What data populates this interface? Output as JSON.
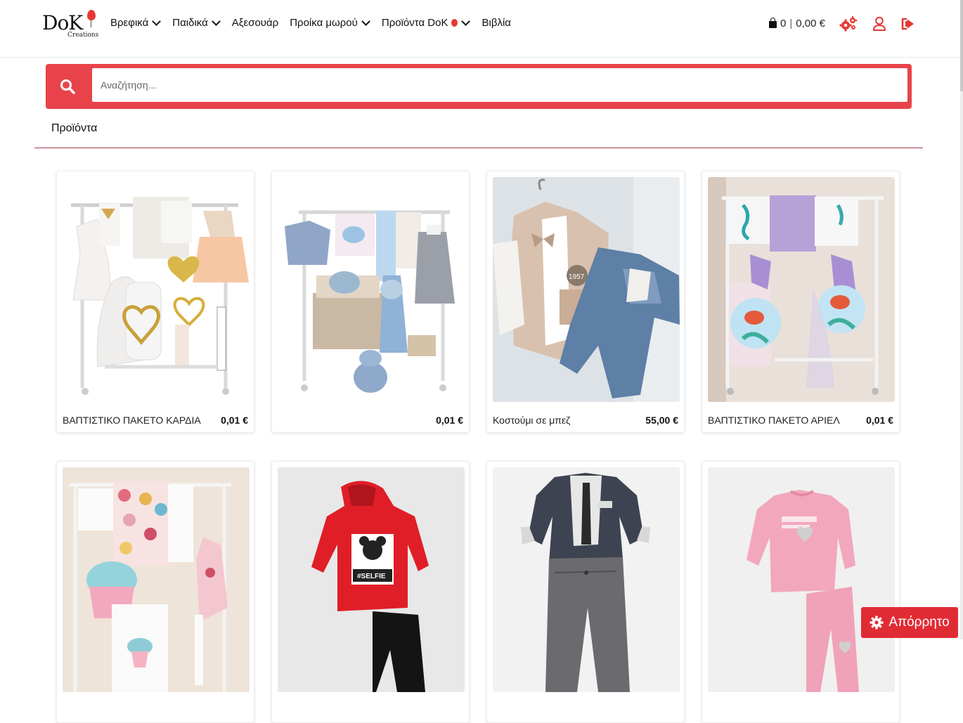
{
  "header": {
    "logo_text": "DoK",
    "logo_sub": "Creations",
    "nav": [
      {
        "label": "Βρεφικά",
        "dropdown": true
      },
      {
        "label": "Παιδικά",
        "dropdown": true
      },
      {
        "label": "Αξεσουάρ",
        "dropdown": false
      },
      {
        "label": "Προίκα μωρού",
        "dropdown": true
      },
      {
        "label": "Προϊόντα DoK",
        "dropdown": true,
        "balloon": true
      },
      {
        "label": "Βιβλία",
        "dropdown": false
      }
    ],
    "cart_count": "0",
    "cart_sep": "|",
    "cart_total": "0,00 €",
    "icons": [
      "bag-icon",
      "gears-icon",
      "user-icon",
      "logout-icon"
    ]
  },
  "search": {
    "placeholder": "Αναζήτηση...",
    "value": ""
  },
  "breadcrumb": "Προϊόντα",
  "colors": {
    "accent": "#e8434a",
    "divider": "#a63d4c",
    "cookie": "#e12b34"
  },
  "products": [
    {
      "name": "ΒΑΠΤΙΣΤΙΚΟ ΠΑΚΕΤΟ ΚΑΡΔΙΑ",
      "price": "0,01 €"
    },
    {
      "name": "",
      "price": "0,01 €"
    },
    {
      "name": "Κοστούμι σε μπεζ",
      "price": "55,00 €"
    },
    {
      "name": "ΒΑΠΤΙΣΤΙΚΟ ΠΑΚΕΤΟ ΑΡΙΕΛ",
      "price": "0,01 €"
    },
    {
      "name": "",
      "price": ""
    },
    {
      "name": "",
      "price": ""
    },
    {
      "name": "",
      "price": ""
    },
    {
      "name": "",
      "price": ""
    }
  ],
  "image_texts": {
    "suit_patch": "1957",
    "hoodie_print": "#SELFIE"
  },
  "cookie_button": {
    "label": "Απόρρητο",
    "icon": "gear-icon"
  }
}
